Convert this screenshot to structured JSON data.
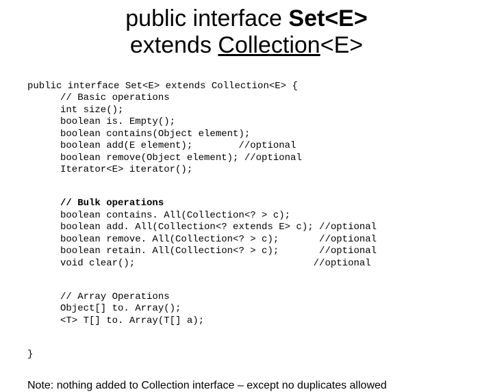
{
  "title": {
    "l1_pre": "public interface ",
    "l1_bold": "Set<E>",
    "l2_pre": "extends ",
    "l2_link": "Collection",
    "l2_post": "<E>"
  },
  "code": {
    "sig": "public interface Set<E> extends Collection<E> {",
    "c1": "// Basic operations",
    "b1": "int size();",
    "b2": "boolean is. Empty();",
    "b3": "boolean contains(Object element);",
    "b4": "boolean add(E element);        //optional",
    "b5": "boolean remove(Object element); //optional",
    "b6": "Iterator<E> iterator();",
    "c2": "// Bulk operations",
    "k1": "boolean contains. All(Collection<? > c);",
    "k2": "boolean add. All(Collection<? extends E> c); //optional",
    "k3": "boolean remove. All(Collection<? > c);       //optional",
    "k4": "boolean retain. All(Collection<? > c);       //optional",
    "k5": "void clear();                               //optional",
    "c3": "// Array Operations",
    "a1": "Object[] to. Array();",
    "a2": "<T> T[] to. Array(T[] a);",
    "close": "}"
  },
  "note": "Note: nothing added to Collection interface – except no duplicates allowed"
}
